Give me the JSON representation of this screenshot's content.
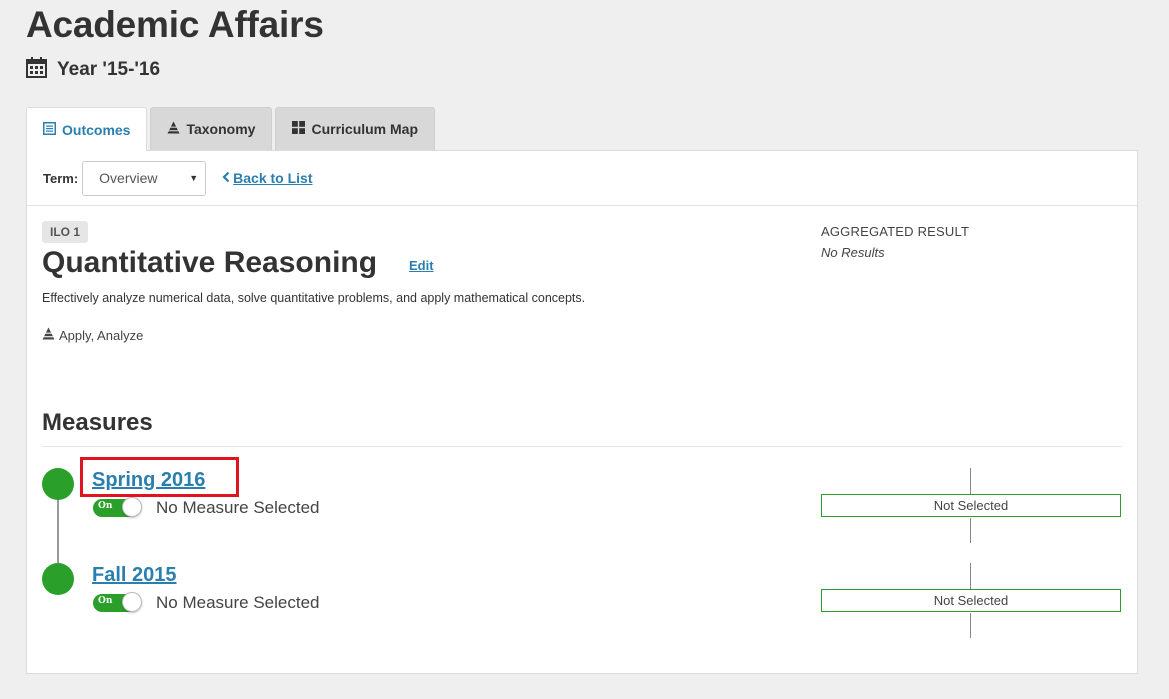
{
  "page": {
    "title": "Academic Affairs",
    "year": "Year '15-'16"
  },
  "tabs": [
    {
      "label": "Outcomes",
      "icon": "list-icon",
      "active": true
    },
    {
      "label": "Taxonomy",
      "icon": "pyramid-icon",
      "active": false
    },
    {
      "label": "Curriculum Map",
      "icon": "grid-icon",
      "active": false
    }
  ],
  "toolbar": {
    "term_label": "Term:",
    "term_value": "Overview",
    "back_label": "Back to List"
  },
  "outcome": {
    "badge": "ILO 1",
    "title": "Quantitative Reasoning",
    "edit_label": "Edit",
    "description": "Effectively analyze numerical data, solve quantitative problems, and apply mathematical concepts.",
    "taxonomy": "Apply, Analyze",
    "aggregated_label": "AGGREGATED RESULT",
    "aggregated_value": "No Results"
  },
  "measures": {
    "title": "Measures",
    "items": [
      {
        "term": "Spring 2016",
        "toggle": "On",
        "status": "No Measure Selected",
        "result": "Not Selected",
        "highlighted": true
      },
      {
        "term": "Fall 2015",
        "toggle": "On",
        "status": "No Measure Selected",
        "result": "Not Selected",
        "highlighted": false
      }
    ]
  },
  "colors": {
    "accent": "#2a7fae",
    "success": "#2aa02a",
    "highlight": "#e0141e"
  }
}
